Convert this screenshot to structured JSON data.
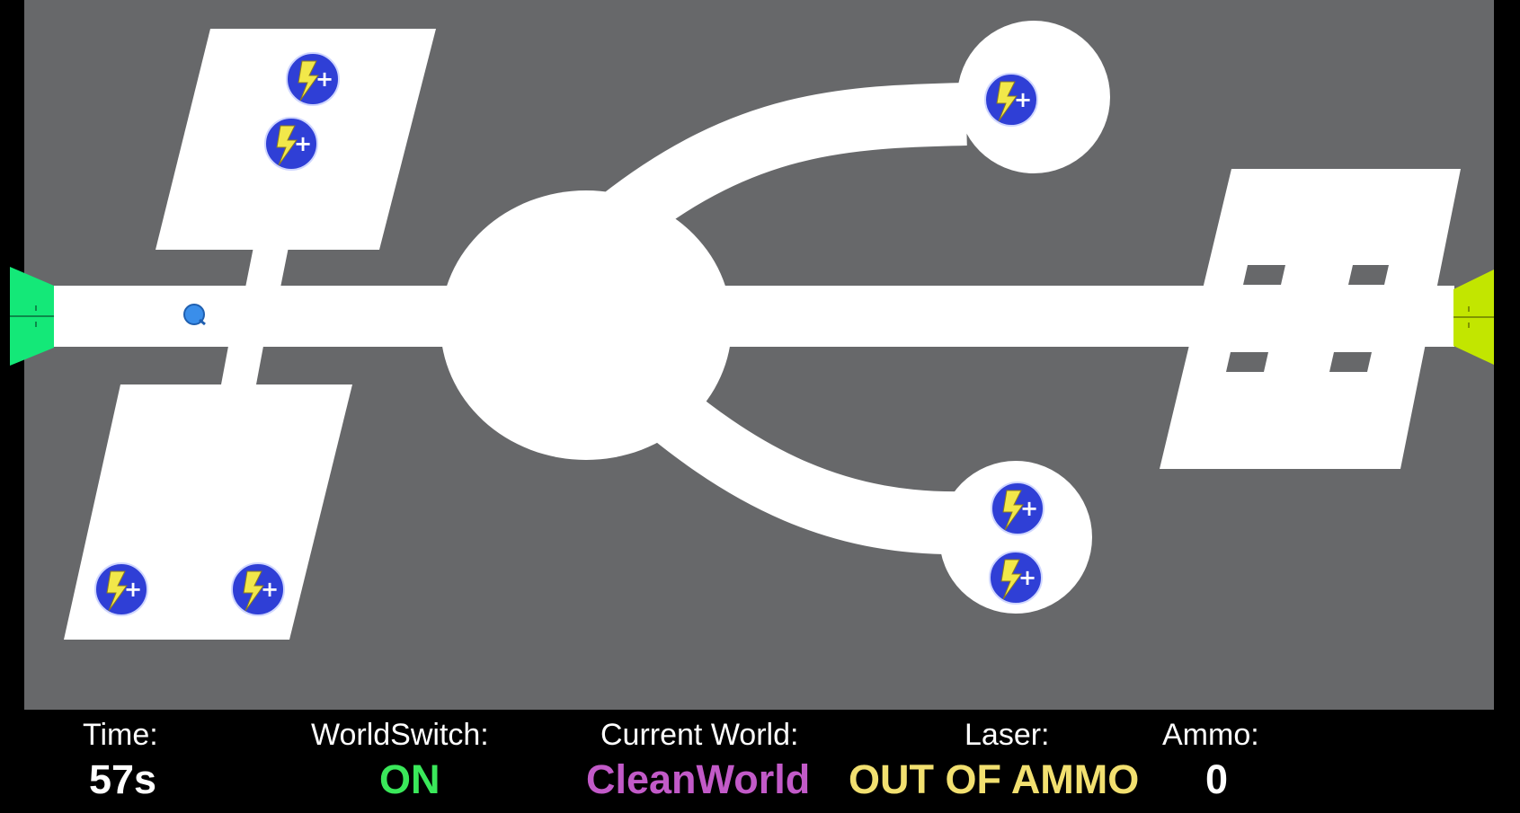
{
  "colors": {
    "background": "#000000",
    "arena": "#67686a",
    "floor": "#ffffff",
    "powerup_fill": "#2f3fd6",
    "powerup_bolt": "#f2e84a",
    "player": "#3a8eea",
    "left_goal": "#14e878",
    "right_goal": "#c2e600",
    "worldswitch_value": "#3ae85a",
    "world_value": "#c25ac8",
    "laser_value": "#f2e070",
    "ammo_value": "#ffffff"
  },
  "icons": {
    "powerup": "lightning-plus-icon",
    "player": "player-orb-icon",
    "goal": "goal-gate-icon"
  },
  "hud": {
    "time_label": "Time:",
    "time_value": "57s",
    "worldswitch_label": "WorldSwitch:",
    "worldswitch_value": "ON",
    "current_world_label": "Current World:",
    "current_world_value": "CleanWorld",
    "laser_label": "Laser:",
    "laser_value": "OUT OF AMMO",
    "ammo_label": "Ammo:",
    "ammo_value": "0"
  }
}
